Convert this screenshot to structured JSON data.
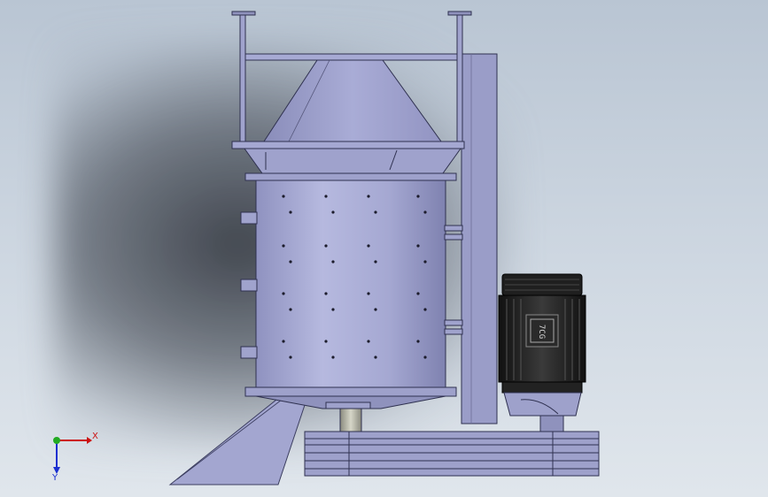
{
  "model": {
    "motor_label": "7CG"
  },
  "triad": {
    "x_label": "X",
    "y_label": "Y"
  },
  "colors": {
    "body": "#9a9cc8",
    "body_dark": "#6e7099",
    "body_light": "#b8bbe2",
    "motor": "#1a1a1a",
    "shaft": "#b8b8a8"
  }
}
